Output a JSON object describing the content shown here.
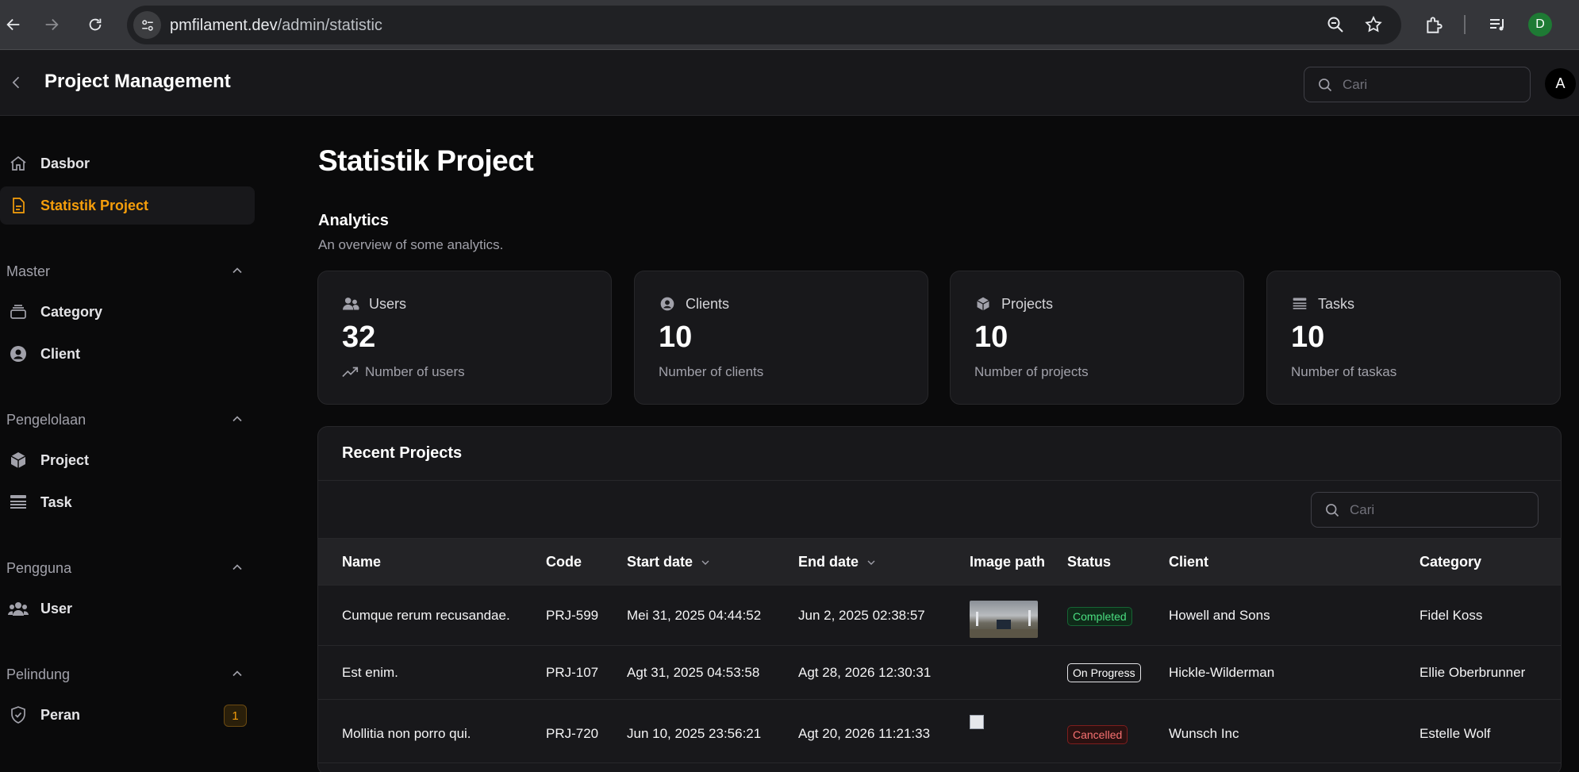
{
  "browser": {
    "url_host": "pmfilament.dev",
    "url_path": "/admin/statistic",
    "profile_initial": "D"
  },
  "app": {
    "title": "Project Management",
    "search_placeholder": "Cari",
    "avatar_initial": "A"
  },
  "sidebar": {
    "top_items": [
      {
        "label": "Dasbor",
        "icon": "home-icon"
      },
      {
        "label": "Statistik Project",
        "icon": "document-icon",
        "active": true
      }
    ],
    "groups": [
      {
        "label": "Master",
        "items": [
          {
            "label": "Category",
            "icon": "stack-icon"
          },
          {
            "label": "Client",
            "icon": "user-circle-icon"
          }
        ]
      },
      {
        "label": "Pengelolaan",
        "items": [
          {
            "label": "Project",
            "icon": "cube-icon"
          },
          {
            "label": "Task",
            "icon": "list-icon"
          }
        ]
      },
      {
        "label": "Pengguna",
        "items": [
          {
            "label": "User",
            "icon": "users-icon"
          }
        ]
      },
      {
        "label": "Pelindung",
        "items": [
          {
            "label": "Peran",
            "icon": "shield-icon",
            "badge": "1"
          }
        ]
      }
    ]
  },
  "page": {
    "title": "Statistik Project",
    "section_heading": "Analytics",
    "section_desc": "An overview of some analytics."
  },
  "stats": [
    {
      "label": "Users",
      "value": "32",
      "desc": "Number of users",
      "icon": "users-icon"
    },
    {
      "label": "Clients",
      "value": "10",
      "desc": "Number of clients",
      "icon": "user-circle-icon"
    },
    {
      "label": "Projects",
      "value": "10",
      "desc": "Number of projects",
      "icon": "cube-icon"
    },
    {
      "label": "Tasks",
      "value": "10",
      "desc": "Number of taskas",
      "icon": "list-icon"
    }
  ],
  "table": {
    "title": "Recent Projects",
    "search_placeholder": "Cari",
    "columns": [
      "Name",
      "Code",
      "Start date",
      "End date",
      "Image path",
      "Status",
      "Client",
      "Category"
    ],
    "rows": [
      {
        "name": "Cumque rerum recusandae.",
        "code": "PRJ-599",
        "start": "Mei 31, 2025 04:44:52",
        "end": "Jun 2, 2025 02:38:57",
        "image": "photo",
        "status": "Completed",
        "status_type": "completed",
        "client": "Howell and Sons",
        "category": "Fidel Koss"
      },
      {
        "name": "Est enim.",
        "code": "PRJ-107",
        "start": "Agt 31, 2025 04:53:58",
        "end": "Agt 28, 2026 12:30:31",
        "image": "none",
        "status": "On Progress",
        "status_type": "progress",
        "client": "Hickle-Wilderman",
        "category": "Ellie Oberbrunner"
      },
      {
        "name": "Mollitia non porro qui.",
        "code": "PRJ-720",
        "start": "Jun 10, 2025 23:56:21",
        "end": "Agt 20, 2026 11:21:33",
        "image": "broken",
        "status": "Cancelled",
        "status_type": "cancelled",
        "client": "Wunsch Inc",
        "category": "Estelle Wolf"
      }
    ]
  },
  "colors": {
    "accent": "#f59e0b",
    "success": "#4ade80",
    "danger": "#f87171",
    "background": "#0a0a0b",
    "card": "#18181b"
  }
}
